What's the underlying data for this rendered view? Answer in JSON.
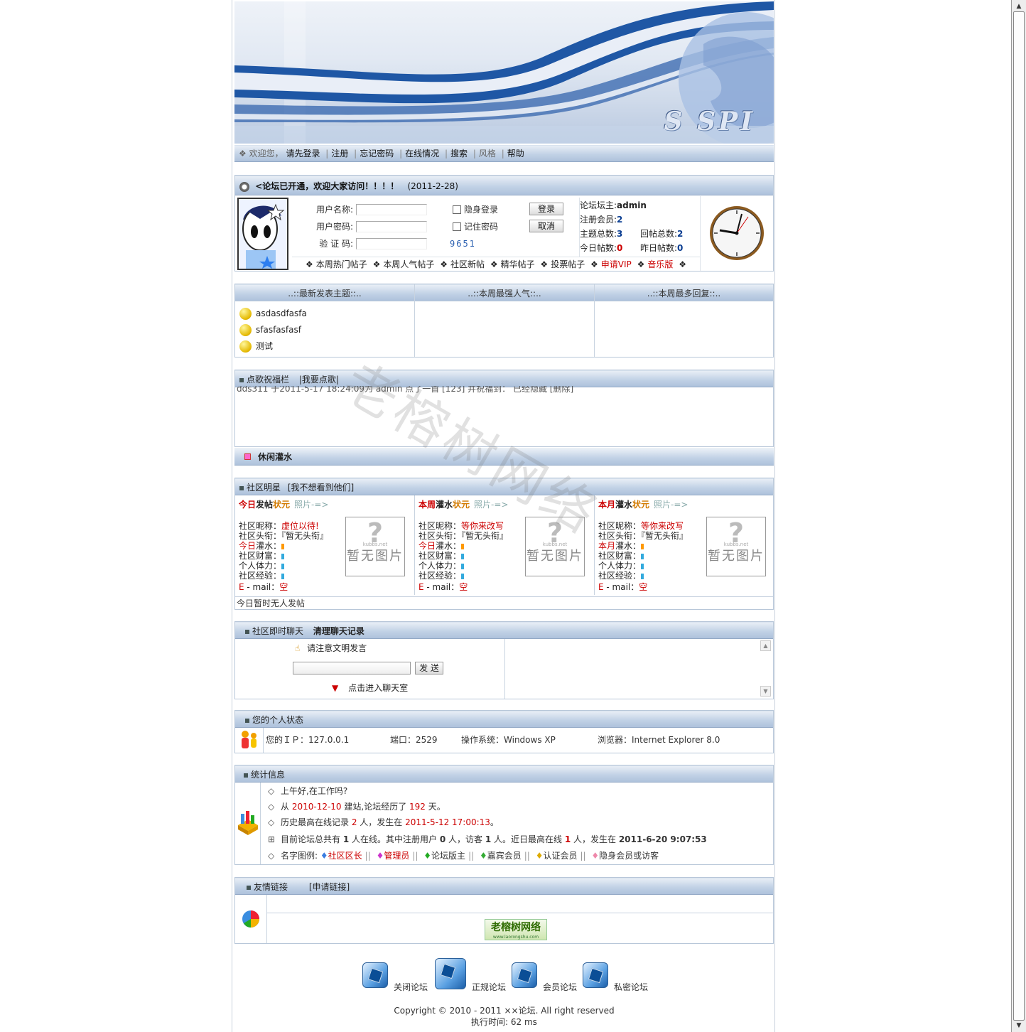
{
  "nav": {
    "welcome": "欢迎您，",
    "login_prompt": "请先登录",
    "register": "注册",
    "forgot": "忘记密码",
    "online": "在线情况",
    "search": "搜索",
    "style": "风格",
    "help": "帮助"
  },
  "notice": {
    "text": "<论坛已开通，欢迎大家访问！！！！",
    "date": "(2011-2-28)"
  },
  "login": {
    "username_label": "用户名称:",
    "password_label": "用户密码:",
    "captcha_label": "验 证 码:",
    "hidden_login": "隐身登录",
    "remember": "记住密码",
    "login_btn": "登录",
    "cancel_btn": "取消",
    "captcha_code": "9651"
  },
  "forum_stats": {
    "owner_label": "论坛坛主:",
    "owner": "admin",
    "members_label": "注册会员:",
    "members": "2",
    "topics_label": "主题总数:",
    "topics": "3",
    "replies_label": "回帖总数:",
    "replies": "2",
    "today_label": "今日帖数:",
    "today": "0",
    "yesterday_label": "昨日帖数:",
    "yesterday": "0"
  },
  "quick_links": [
    "本周热门帖子",
    "本周人气帖子",
    "社区新帖",
    "精华帖子",
    "投票帖子",
    "申请VIP",
    "音乐版"
  ],
  "latest": {
    "headers": [
      "..::最新发表主题::..",
      "..::本周最强人气::..",
      "..::本周最多回复::.."
    ],
    "topics": [
      "asdasdfasfa",
      "sfasfasfasf",
      "测试"
    ]
  },
  "song": {
    "title": "点歌祝福栏",
    "request": "|我要点歌|",
    "scroll": "dds311 于2011-5-17 18:24:09为 admin 点了一首 [123] 并祝福到：          已经隐藏          [删除]"
  },
  "water": {
    "title": "休闲灌水"
  },
  "stars": {
    "title": "社区明星",
    "hide": "[我不想看到他们]",
    "photo_link": "照片-=>",
    "cols": [
      {
        "p1": "今日",
        "p2": "发帖",
        "p3": "状元",
        "nick": "虚位以待!",
        "period": "今日",
        "act": "灌水："
      },
      {
        "p1": "本周",
        "p2": "灌水",
        "p3": "状元",
        "nick": "等你来改写",
        "period": "今日",
        "act": "灌水："
      },
      {
        "p1": "本月",
        "p2": "灌水",
        "p3": "状元",
        "nick": "等你来改写",
        "period": "本月",
        "act": "灌水："
      }
    ],
    "nick_label": "社区昵称：",
    "title_label": "社区头衔：",
    "title_value": "『暂无头衔』",
    "wealth_label": "社区财富：",
    "stamina_label": "个人体力：",
    "exp_label": "社区经验：",
    "email_label": "E - mail：",
    "email_value": "空",
    "noimg_q": "?",
    "noimg_site": "kubbs.net",
    "noimg_text": "暂无图片",
    "footer": "今日暂时无人发帖"
  },
  "chat": {
    "title": "社区即时聊天",
    "clear": "清理聊天记录",
    "notice": "请注意文明发言",
    "send": "发 送",
    "enter": "点击进入聊天室"
  },
  "personal": {
    "title": "您的个人状态",
    "ip_label": "您的ＩＰ：",
    "ip": "127.0.0.1",
    "port_label": "端口：",
    "port": "2529",
    "os_label": "操作系统：",
    "os": "Windows XP",
    "browser_label": "浏览器：",
    "browser": "Internet Explorer 8.0"
  },
  "stats": {
    "title": "统计信息",
    "greet": "上午好,在工作吗?",
    "since_a": "从 ",
    "since_date": "2010-12-10",
    "since_b": " 建站,论坛经历了 ",
    "since_days": "192",
    "since_c": " 天。",
    "peak_a": "历史最高在线记录 ",
    "peak_n": "2",
    "peak_b": " 人，发生在 ",
    "peak_date": "2011-5-12 17:00:13",
    "peak_c": "。",
    "now_a": "目前论坛总共有 ",
    "now_total": "1",
    "now_b": " 人在线。其中注册用户 ",
    "now_reg": "0",
    "now_c": " 人，访客 ",
    "now_guest": "1",
    "now_d": " 人。近日最高在线 ",
    "now_peak": "1",
    "now_e": " 人，发生在 ",
    "now_date": "2011-6-20 9:07:53",
    "legend_label": "名字图例:",
    "legend": [
      "社区区长",
      "管理员",
      "论坛版主",
      "嘉宾会员",
      "认证会员",
      "隐身会员或访客"
    ]
  },
  "links": {
    "title": "友情链接",
    "apply": "[申请链接]",
    "logo_text": "老榕树网络",
    "logo_sub": "www.laorongshu.com"
  },
  "legend_icons": [
    "关闭论坛",
    "正规论坛",
    "会员论坛",
    "私密论坛"
  ],
  "footer": {
    "copyright": "Copyright © 2010 - 2011 ××论坛. All right reserved",
    "exec": "执行时间: 62 ms"
  },
  "watermark": "老榕树网络",
  "banner_logo": "S SPI"
}
